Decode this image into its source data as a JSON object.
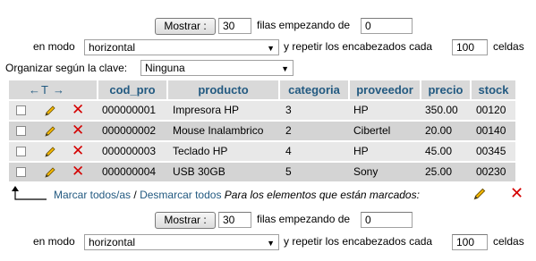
{
  "nav_top": {
    "show_button": "Mostrar :",
    "rows_value": "30",
    "rows_text": "filas empezando de",
    "start_value": "0",
    "mode_label": "en modo",
    "mode_value": "horizontal",
    "repeat_text": "y repetir los encabezados cada",
    "repeat_value": "100",
    "cells_text": "celdas"
  },
  "sort": {
    "label": "Organizar según la clave:",
    "value": "Ninguna"
  },
  "table": {
    "columns": [
      "cod_pro",
      "producto",
      "categoria",
      "proveedor",
      "precio",
      "stock"
    ],
    "rows": [
      {
        "cod_pro": "000000001",
        "producto": "Impresora HP",
        "categoria": "3",
        "proveedor": "HP",
        "precio": "350.00",
        "stock": "00120"
      },
      {
        "cod_pro": "000000002",
        "producto": "Mouse Inalambrico",
        "categoria": "2",
        "proveedor": "Cibertel",
        "precio": "20.00",
        "stock": "00140"
      },
      {
        "cod_pro": "000000003",
        "producto": "Teclado HP",
        "categoria": "4",
        "proveedor": "HP",
        "precio": "45.00",
        "stock": "00345"
      },
      {
        "cod_pro": "000000004",
        "producto": "USB 30GB",
        "categoria": "5",
        "proveedor": "Sony",
        "precio": "25.00",
        "stock": "00230"
      }
    ]
  },
  "footer": {
    "check_all": "Marcar todos/as",
    "separator": "/",
    "uncheck_all": "Desmarcar todos",
    "marked_text": "Para los elementos que están marcados:"
  },
  "nav_bottom": {
    "show_button": "Mostrar :",
    "rows_value": "30",
    "rows_text": "filas empezando de",
    "start_value": "0",
    "mode_label": "en modo",
    "mode_value": "horizontal",
    "repeat_text": "y repetir los encabezados cada",
    "repeat_value": "100",
    "cells_text": "celdas"
  },
  "colors": {
    "link": "#235a81",
    "header_bg": "#d9d9d9",
    "row_odd": "#e8e8e8",
    "row_even": "#d4d4d4",
    "delete": "#d40000"
  }
}
